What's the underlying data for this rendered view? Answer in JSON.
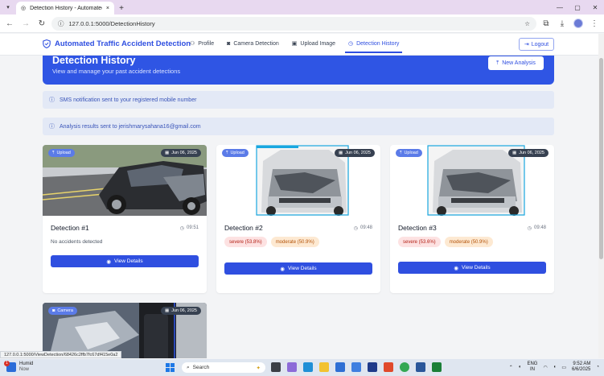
{
  "browser": {
    "tab_title": "Detection History - Automated",
    "url": "127.0.0.1:5000/DetectionHistory"
  },
  "nav": {
    "brand": "Automated Traffic Accident Detection",
    "links": [
      "Profile",
      "Camera Detection",
      "Upload Image",
      "Detection History"
    ],
    "active_link": "Detection History",
    "logout": "Logout"
  },
  "hero": {
    "title": "Detection History",
    "subtitle": "View and manage your past accident detections",
    "new_analysis": "New Analysis"
  },
  "notices": [
    "SMS notification sent to your registered mobile number",
    "Analysis results sent to jerishmarysahana16@gmail.com"
  ],
  "cards": [
    {
      "source": "Upload",
      "date": "Jun 06, 2025",
      "title": "Detection #1",
      "time": "09:51",
      "message": "No accidents detected",
      "tags": [],
      "button": "View Details"
    },
    {
      "source": "Upload",
      "date": "Jun 06, 2025",
      "title": "Detection #2",
      "time": "09:48",
      "message": "",
      "tags": [
        "severe (53.8%)",
        "moderate (50.9%)"
      ],
      "button": "View Details"
    },
    {
      "source": "Upload",
      "date": "Jun 06, 2025",
      "title": "Detection #3",
      "time": "09:48",
      "message": "",
      "tags": [
        "severe (53.6%)",
        "moderate (50.9%)"
      ],
      "button": "View Details"
    },
    {
      "source": "Camera",
      "date": "Jun 06, 2025"
    }
  ],
  "status_url": "127.0.0.1:5000/ViewDetection/68426c2ffb7fc67df415e0a2",
  "taskbar": {
    "weather_line1": "Humid",
    "weather_line2": "Now",
    "weather_badge": "1",
    "search": "Search",
    "lang_line1": "ENG",
    "lang_line2": "IN",
    "time": "9:52 AM",
    "date": "6/6/2025"
  },
  "colors": {
    "primary": "#2f4fe0",
    "hero": "#2f55e4",
    "notice_bg": "#e3e9f6",
    "severe_bg": "#fde2e2",
    "moderate_bg": "#fde9d2"
  }
}
